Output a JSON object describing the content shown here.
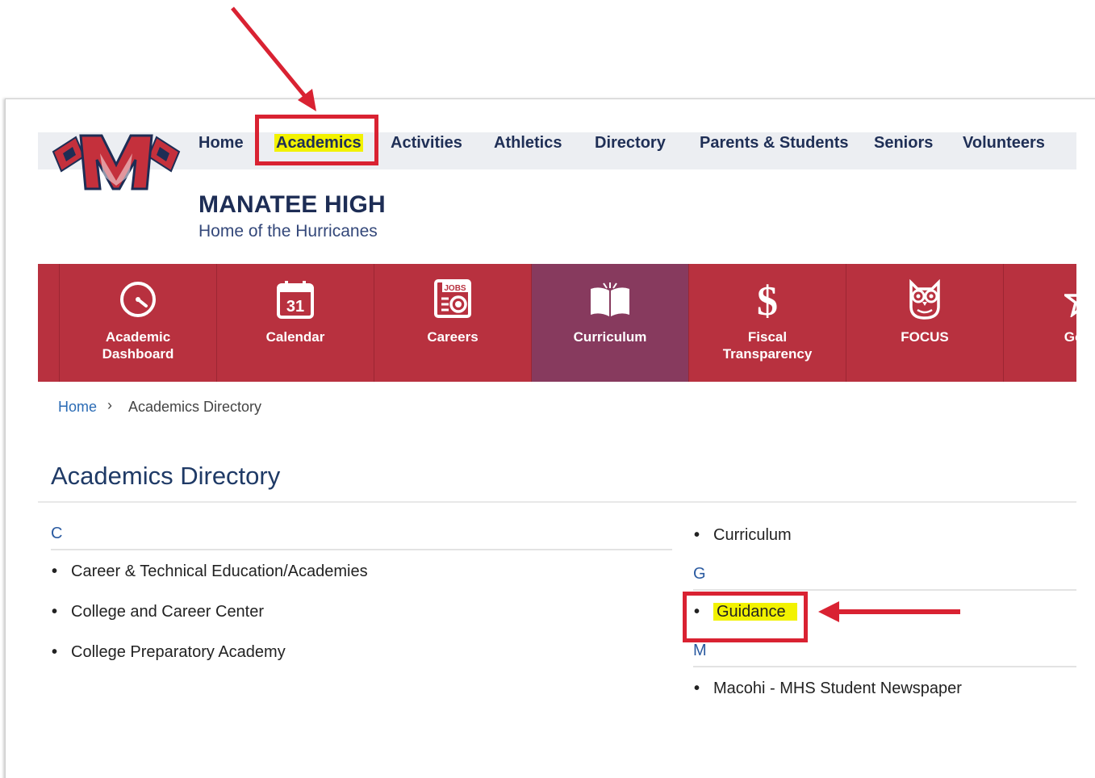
{
  "header": {
    "nav": [
      "Home",
      "Academics",
      "Activities",
      "Athletics",
      "Directory",
      "Parents & Students",
      "Seniors",
      "Volunteers"
    ],
    "school_name": "MANATEE HIGH",
    "tagline": "Home of the Hurricanes",
    "logo_letter": "M"
  },
  "quick_links": [
    {
      "label": "Academic Dashboard",
      "icon": "speedometer-icon"
    },
    {
      "label": "Calendar",
      "icon": "calendar-icon",
      "day": "31"
    },
    {
      "label": "Careers",
      "icon": "jobs-newspaper-icon",
      "tag": "JOBS"
    },
    {
      "label": "Curriculum",
      "icon": "open-book-icon"
    },
    {
      "label": "Fiscal Transparency",
      "icon": "dollar-icon",
      "symbol": "$"
    },
    {
      "label": "FOCUS",
      "icon": "owl-icon"
    },
    {
      "label": "Good",
      "icon": "star-icon"
    }
  ],
  "breadcrumb": {
    "home": "Home",
    "current": "Academics Directory"
  },
  "page_title": "Academics Directory",
  "directory": {
    "left": {
      "letter": "C",
      "items": [
        "Career & Technical Education/Academies",
        "College and Career Center",
        "College Preparatory Academy"
      ]
    },
    "right": {
      "top_items": [
        "Curriculum"
      ],
      "groups": [
        {
          "letter": "G",
          "items": [
            "Guidance"
          ]
        },
        {
          "letter": "M",
          "items": [
            "Macohi - MHS Student Newspaper"
          ]
        }
      ]
    }
  },
  "colors": {
    "nav_text": "#1f2f56",
    "quick_bar": "#b8313f",
    "quick_active": "#873a5e",
    "highlight": "#f2f200",
    "annotation": "#d92232"
  }
}
